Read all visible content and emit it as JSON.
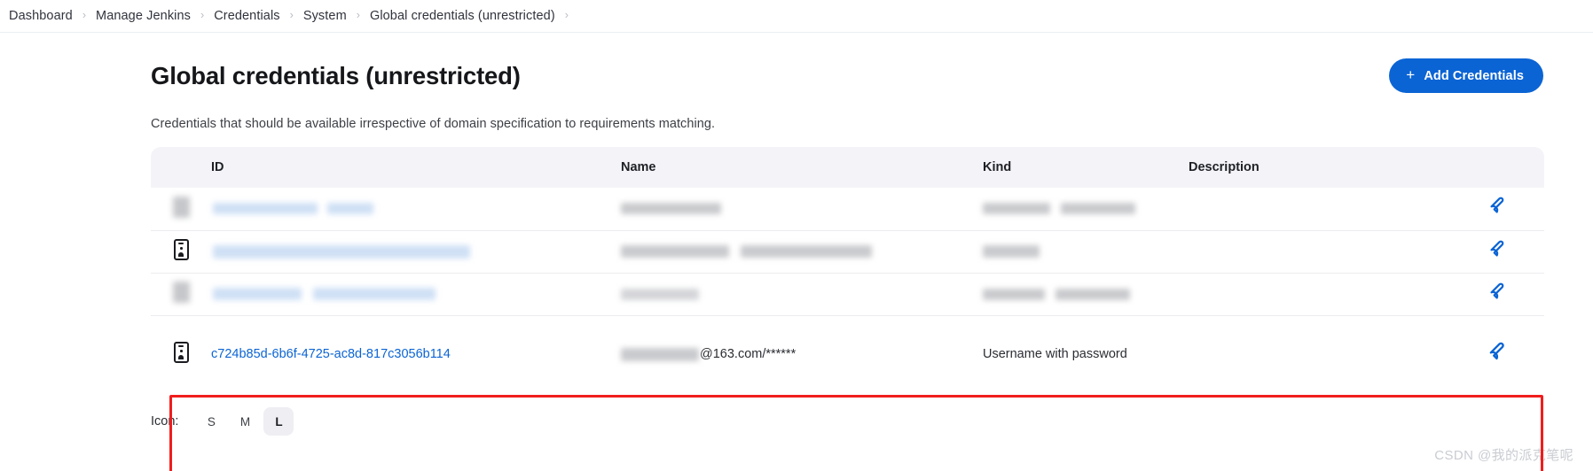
{
  "breadcrumb": {
    "separator": "›",
    "items": [
      {
        "label": "Dashboard"
      },
      {
        "label": "Manage Jenkins"
      },
      {
        "label": "Credentials"
      },
      {
        "label": "System"
      },
      {
        "label": "Global credentials (unrestricted)"
      }
    ]
  },
  "header": {
    "title": "Global credentials (unrestricted)",
    "add_button": {
      "label": "Add Credentials",
      "icon": "plus-icon",
      "color": "#0b64d4"
    }
  },
  "description": "Credentials that should be available irrespective of domain specification to requirements matching.",
  "table": {
    "columns": [
      "",
      "ID",
      "Name",
      "Kind",
      "Description",
      ""
    ],
    "rows": [
      {
        "icon": "redacted-icon",
        "id": "",
        "name": "",
        "kind": "",
        "description": "",
        "redacted": true,
        "action_icon": "wrench-icon",
        "highlighted": false
      },
      {
        "icon": "id-badge-icon",
        "id": "",
        "name": "",
        "kind": "",
        "description": "",
        "redacted": true,
        "action_icon": "wrench-icon",
        "highlighted": false
      },
      {
        "icon": "redacted-icon",
        "id": "",
        "name": "",
        "kind": "",
        "description": "",
        "redacted": true,
        "action_icon": "wrench-icon",
        "highlighted": false
      },
      {
        "icon": "id-badge-icon",
        "id": "c724b85d-6b6f-4725-ac8d-817c3056b114",
        "name_suffix": "@163.com/******",
        "kind": "Username with password",
        "description": "",
        "redacted": false,
        "action_icon": "wrench-icon",
        "highlighted": true
      }
    ]
  },
  "icon_size": {
    "label": "Icon:",
    "options": [
      "S",
      "M",
      "L"
    ],
    "selected": "L"
  },
  "watermark": "CSDN @我的派克笔呢",
  "colors": {
    "accent": "#0b64d4",
    "highlight_box": "#f01d1d",
    "table_header_bg": "#f4f4f8"
  }
}
